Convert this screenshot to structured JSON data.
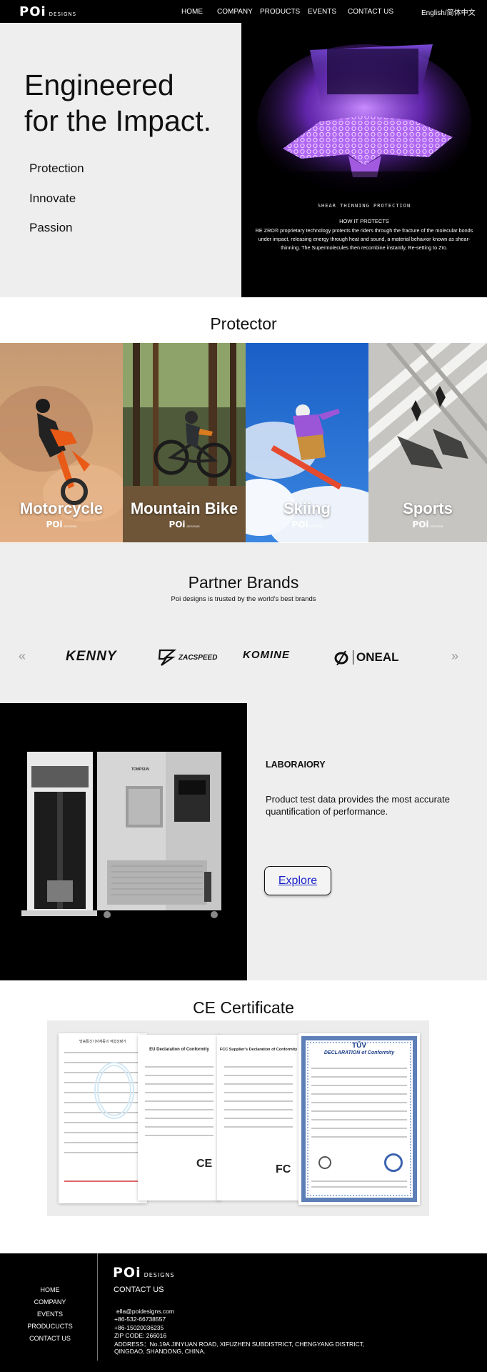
{
  "header": {
    "logo_main": "POi",
    "logo_sub": "DESIGNS",
    "nav": [
      "HOME",
      "COMPANY",
      "PRODUCTS",
      "EVENTS",
      "CONTACT US"
    ],
    "language": "English/简体中文"
  },
  "hero": {
    "title_line1": "Engineered",
    "title_line2": "for the Impact.",
    "items": [
      "Protection",
      "Innovate",
      "Passion"
    ],
    "image_caption": "SHEAR THINNING PROTECTION",
    "image_heading": "HOW IT PROTECTS",
    "image_text_1": "RE ZRO® proprietary technology protects the riders through the fracture of the molecular bonds",
    "image_text_2": "under impact, releasing energy through heat and sound, a material behavior known as shear-",
    "image_text_3": "thinning. The Supermolecules then recombine instantly, Re-setting to Zro."
  },
  "protector": {
    "title": "Protector",
    "categories": [
      {
        "label": "Motorcycle",
        "logo": "POi",
        "logo_sub": "DESIGNS"
      },
      {
        "label": "Mountain Bike",
        "logo": "POi",
        "logo_sub": "DESIGNS"
      },
      {
        "label": "Skiing",
        "logo": "POi",
        "logo_sub": "DESIGNS"
      },
      {
        "label": "Sports",
        "logo": "POi",
        "logo_sub": "DESIGNS"
      }
    ]
  },
  "partners": {
    "title": "Partner Brands",
    "subtitle": "Poi designs is trusted by the world's best brands",
    "prev": "«",
    "next": "»",
    "brands": [
      "KENNY",
      "ZACSPEED",
      "KOMINE",
      "ONEAL"
    ]
  },
  "laboratory": {
    "heading": "LABORAIORY",
    "text_line1": "Product test data provides the most accurate",
    "text_line2": "quantification of performance.",
    "button": "Explore",
    "machine_label": "TOMPSUN"
  },
  "certificate": {
    "title": "CE Certificate",
    "docs": [
      {
        "title": "방송통신기자재등의 적합성평가"
      },
      {
        "title": "EU Declaration of Conformity"
      },
      {
        "title": "FCC Supplier's Declaration of Conformity"
      },
      {
        "title": "DECLARATION of Conformity",
        "brand": "TÜV"
      }
    ],
    "ce_mark": "CE",
    "fcc_mark": "FC"
  },
  "footer": {
    "links": [
      "HOME",
      "COMPANY",
      "EVENTS",
      "PRODUCUCTS",
      "CONTACT US"
    ],
    "logo_main": "POi",
    "logo_sub": "DESIGNS",
    "contact_title": "CONTACT US",
    "email": "ella@poidesigns.com",
    "phone1": "+86-532-66738557",
    "phone2": "+86-15020036235",
    "zip": "ZIP CODE: 266016",
    "address1": "ADDRESS：No.19A JINYUAN ROAD, XIFUZHEN SUBDISTRICT, CHENGYANG DISTRICT,",
    "address2": "QINGDAO, SHANDONG, CHINA."
  },
  "colors": {
    "header_bg": "#000000",
    "hero_panel": "#eeeeee",
    "glow": "#b35cff",
    "explore_link": "#1a23c8"
  }
}
